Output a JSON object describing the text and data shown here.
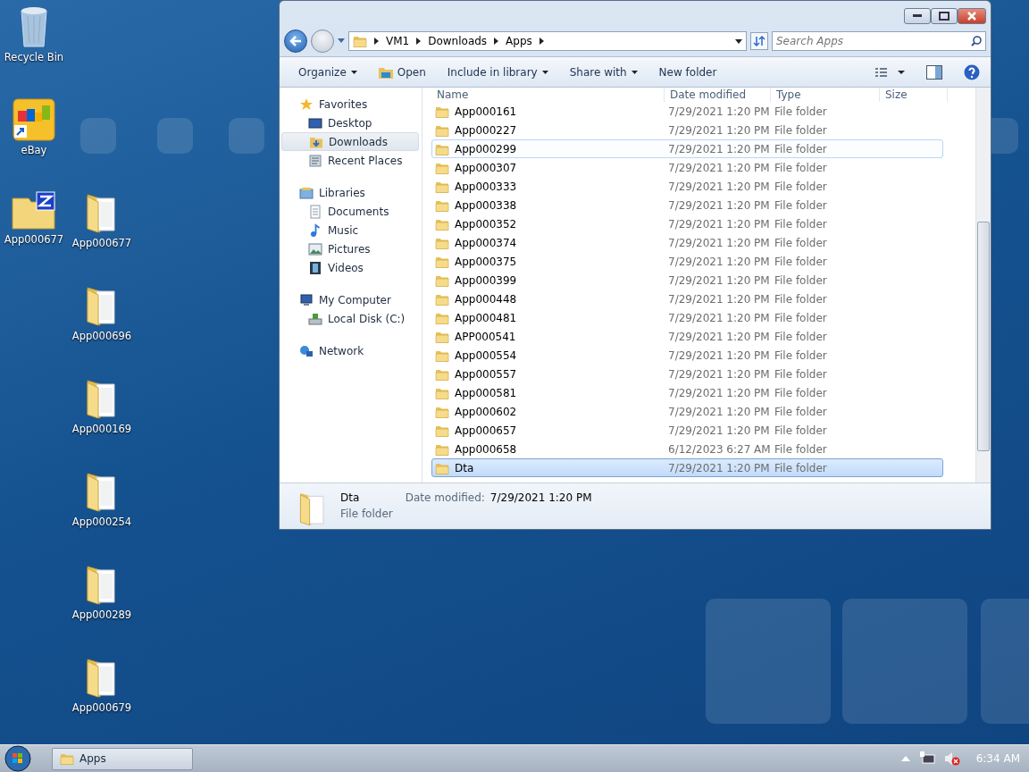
{
  "desktop_icons": [
    {
      "label": "Recycle Bin",
      "kind": "recycle"
    },
    {
      "label": "eBay",
      "kind": "shortcut"
    },
    {
      "label": "App000677",
      "kind": "archive"
    },
    {
      "label": "App000677",
      "kind": "folder"
    },
    {
      "label": "App000696",
      "kind": "folder"
    },
    {
      "label": "App000169",
      "kind": "folder"
    },
    {
      "label": "App000254",
      "kind": "folder"
    },
    {
      "label": "App000289",
      "kind": "folder"
    },
    {
      "label": "App000679",
      "kind": "folder"
    }
  ],
  "window": {
    "address": [
      "VM1",
      "Downloads",
      "Apps"
    ],
    "search": {
      "placeholder": "Search Apps"
    },
    "toolbar": [
      {
        "label": "Organize",
        "kind": "menu"
      },
      {
        "label": "Open",
        "kind": "open"
      },
      {
        "label": "Include in library",
        "kind": "menu"
      },
      {
        "label": "Share with",
        "kind": "menu"
      },
      {
        "label": "New folder",
        "kind": "plain"
      }
    ],
    "nav": [
      {
        "label": "Favorites",
        "kind": "star",
        "selected": false,
        "children": [
          {
            "label": "Desktop",
            "kind": "desktop",
            "selected": false
          },
          {
            "label": "Downloads",
            "kind": "downloads",
            "selected": true
          },
          {
            "label": "Recent Places",
            "kind": "recent",
            "selected": false
          }
        ]
      },
      {
        "label": "Libraries",
        "kind": "library",
        "selected": false,
        "children": [
          {
            "label": "Documents",
            "kind": "document",
            "selected": false
          },
          {
            "label": "Music",
            "kind": "music",
            "selected": false
          },
          {
            "label": "Pictures",
            "kind": "picture",
            "selected": false
          },
          {
            "label": "Videos",
            "kind": "video",
            "selected": false
          }
        ]
      },
      {
        "label": "My Computer",
        "kind": "computer",
        "selected": false,
        "children": [
          {
            "label": "Local Disk (C:)",
            "kind": "disk",
            "selected": false
          }
        ]
      },
      {
        "label": "Network",
        "kind": "network",
        "selected": false
      }
    ],
    "columns": [
      "Name",
      "Date modified",
      "Type",
      "Size"
    ],
    "rows": [
      {
        "name": "App000161",
        "date": "7/29/2021 1:20 PM",
        "type": "File folder",
        "selected": false,
        "hovered": false
      },
      {
        "name": "App000227",
        "date": "7/29/2021 1:20 PM",
        "type": "File folder",
        "selected": false,
        "hovered": false
      },
      {
        "name": "App000299",
        "date": "7/29/2021 1:20 PM",
        "type": "File folder",
        "selected": false,
        "hovered": true
      },
      {
        "name": "App000307",
        "date": "7/29/2021 1:20 PM",
        "type": "File folder",
        "selected": false,
        "hovered": false
      },
      {
        "name": "App000333",
        "date": "7/29/2021 1:20 PM",
        "type": "File folder",
        "selected": false,
        "hovered": false
      },
      {
        "name": "App000338",
        "date": "7/29/2021 1:20 PM",
        "type": "File folder",
        "selected": false,
        "hovered": false
      },
      {
        "name": "App000352",
        "date": "7/29/2021 1:20 PM",
        "type": "File folder",
        "selected": false,
        "hovered": false
      },
      {
        "name": "App000374",
        "date": "7/29/2021 1:20 PM",
        "type": "File folder",
        "selected": false,
        "hovered": false
      },
      {
        "name": "App000375",
        "date": "7/29/2021 1:20 PM",
        "type": "File folder",
        "selected": false,
        "hovered": false
      },
      {
        "name": "App000399",
        "date": "7/29/2021 1:20 PM",
        "type": "File folder",
        "selected": false,
        "hovered": false
      },
      {
        "name": "App000448",
        "date": "7/29/2021 1:20 PM",
        "type": "File folder",
        "selected": false,
        "hovered": false
      },
      {
        "name": "App000481",
        "date": "7/29/2021 1:20 PM",
        "type": "File folder",
        "selected": false,
        "hovered": false
      },
      {
        "name": "APP000541",
        "date": "7/29/2021 1:20 PM",
        "type": "File folder",
        "selected": false,
        "hovered": false
      },
      {
        "name": "App000554",
        "date": "7/29/2021 1:20 PM",
        "type": "File folder",
        "selected": false,
        "hovered": false
      },
      {
        "name": "App000557",
        "date": "7/29/2021 1:20 PM",
        "type": "File folder",
        "selected": false,
        "hovered": false
      },
      {
        "name": "App000581",
        "date": "7/29/2021 1:20 PM",
        "type": "File folder",
        "selected": false,
        "hovered": false
      },
      {
        "name": "App000602",
        "date": "7/29/2021 1:20 PM",
        "type": "File folder",
        "selected": false,
        "hovered": false
      },
      {
        "name": "App000657",
        "date": "7/29/2021 1:20 PM",
        "type": "File folder",
        "selected": false,
        "hovered": false
      },
      {
        "name": "App000658",
        "date": "6/12/2023 6:27 AM",
        "type": "File folder",
        "selected": false,
        "hovered": false
      },
      {
        "name": "Dta",
        "date": "7/29/2021 1:20 PM",
        "type": "File folder",
        "selected": true,
        "hovered": false
      }
    ],
    "details": {
      "name": "Dta",
      "date_label": "Date modified:",
      "date": "7/29/2021 1:20 PM",
      "type": "File folder"
    }
  },
  "taskbar": {
    "buttons": [
      {
        "label": "Apps",
        "selected": true
      }
    ],
    "clock": "6:34 AM"
  }
}
